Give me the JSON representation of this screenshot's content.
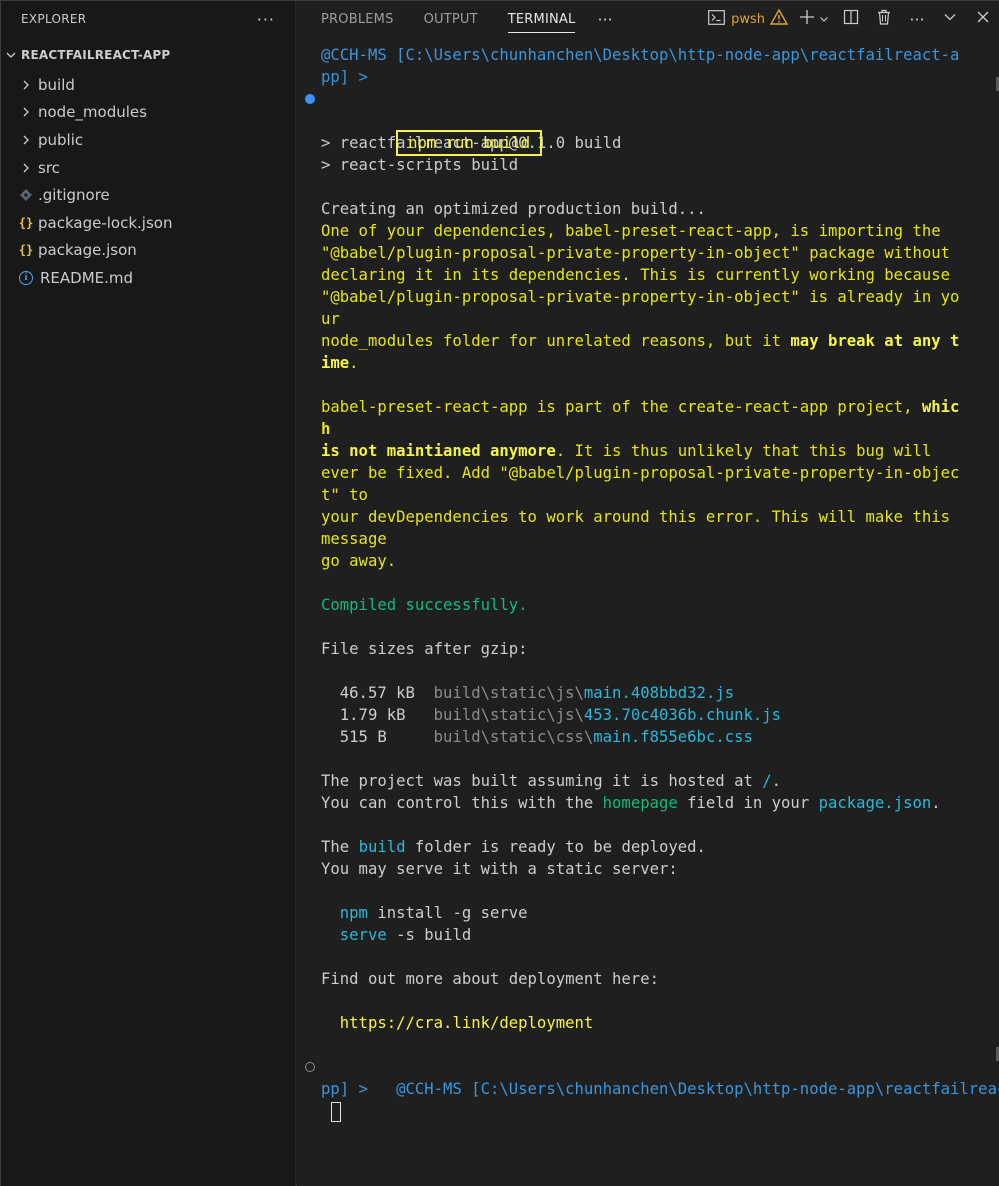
{
  "sidebar": {
    "title": "EXPLORER",
    "more": "···",
    "folder": "REACTFAILREACT-APP",
    "items": [
      {
        "label": "build",
        "icon": "chevron-right-icon"
      },
      {
        "label": "node_modules",
        "icon": "chevron-right-icon"
      },
      {
        "label": "public",
        "icon": "chevron-right-icon"
      },
      {
        "label": "src",
        "icon": "chevron-right-icon"
      },
      {
        "label": ".gitignore",
        "icon": "git-icon"
      },
      {
        "label": "package-lock.json",
        "icon": "json-icon"
      },
      {
        "label": "package.json",
        "icon": "json-icon"
      },
      {
        "label": "README.md",
        "icon": "info-icon"
      }
    ]
  },
  "panel": {
    "tabs": [
      {
        "label": "PROBLEMS"
      },
      {
        "label": "OUTPUT"
      },
      {
        "label": "TERMINAL",
        "active": true
      }
    ],
    "more": "···",
    "shell": "pwsh"
  },
  "terminal": {
    "prompt1": "@CCH-MS [C:\\Users\\chunhanchen\\Desktop\\http-node-app\\reactfailreact-a",
    "prompt1b": "pp] >",
    "command": "npm run build",
    "l1": "> reactfailreact-app@0.1.0 build",
    "l2": "> react-scripts build",
    "creating": "Creating an optimized production build...",
    "w1": "One of your dependencies, babel-preset-react-app, is importing the",
    "w2": "\"@babel/plugin-proposal-private-property-in-object\" package without",
    "w3": "declaring it in its dependencies. This is currently working because",
    "w4": "\"@babel/plugin-proposal-private-property-in-object\" is already in yo",
    "w5": "ur",
    "w6a": "node_modules folder for unrelated reasons, but it ",
    "w6b": "may break at any t",
    "w7a": "ime",
    "w7b": ".",
    "b1a": "babel-preset-react-app is part of the create-react-app project, ",
    "b1b": "whic",
    "b2": "h",
    "b3a": "is not maintianed anymore",
    "b3b": ". It is thus unlikely that this bug will",
    "b4": "ever be fixed. Add \"@babel/plugin-proposal-private-property-in-objec",
    "b5": "t\" to",
    "b6": "your devDependencies to work around this error. This will make this",
    "b7": "message",
    "b8": "go away.",
    "compiled": "Compiled successfully.",
    "sizes_header": "File sizes after gzip:",
    "files": [
      {
        "size": "46.57 kB",
        "dir": "build\\static\\js\\",
        "name": "main.408bbd32.js"
      },
      {
        "size": "1.79 kB ",
        "dir": "build\\static\\js\\",
        "name": "453.70c4036b.chunk.js"
      },
      {
        "size": "515 B   ",
        "dir": "build\\static\\css\\",
        "name": "main.f855e6bc.css"
      }
    ],
    "h1a": "The project was built assuming it is hosted at ",
    "h1b": "/",
    "h1c": ".",
    "h2a": "You can control this with the ",
    "h2b": "homepage",
    "h2c": " field in your ",
    "h2d": "package.json",
    "h2e": ".",
    "r1a": "The ",
    "r1b": "build",
    "r1c": " folder is ready to be deployed.",
    "r2": "You may serve it with a static server:",
    "s1a": "npm",
    "s1b": " install -g serve",
    "s2a": "serve",
    "s2b": " -s build",
    "find": "Find out more about deployment here:",
    "link": "https://cra.link/deployment",
    "prompt2": "@CCH-MS [C:\\Users\\chunhanchen\\Desktop\\http-node-app\\reactfailreact-a",
    "prompt2b": "pp] >"
  }
}
